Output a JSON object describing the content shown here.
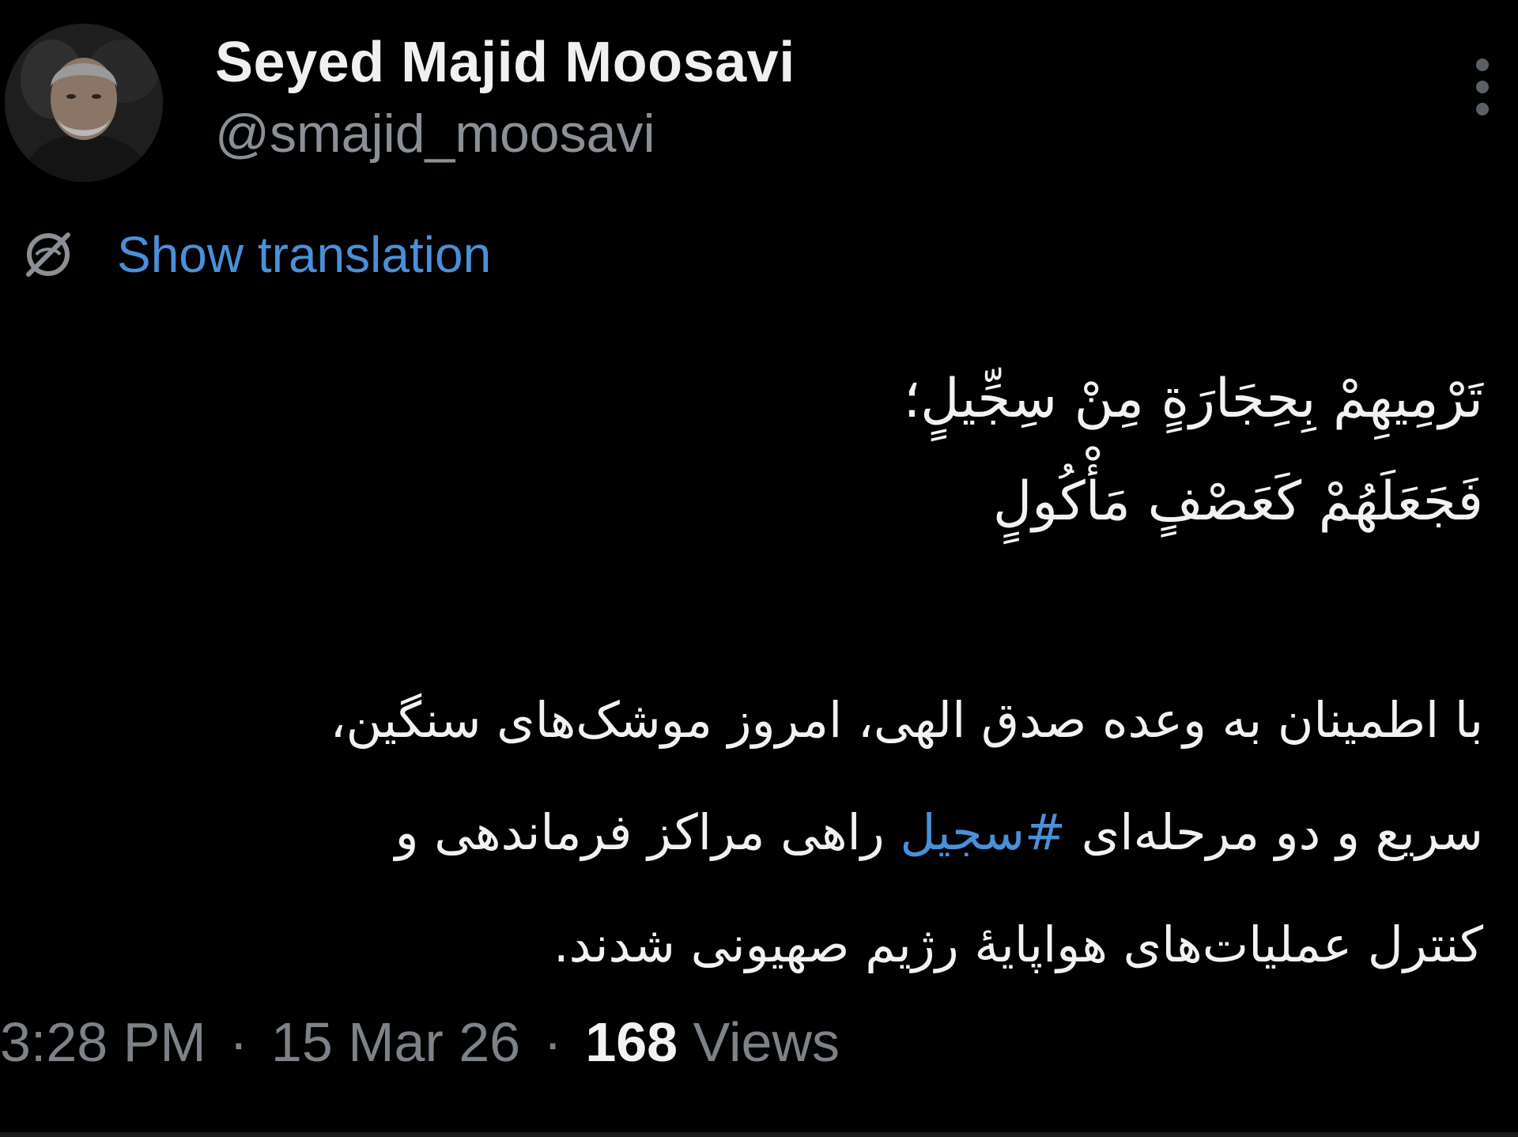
{
  "author": {
    "name": "Seyed Majid Moosavi",
    "handle": "@smajid_moosavi"
  },
  "icons": {
    "avatar": "profile-photo",
    "more": "more-options-icon",
    "translate": "translate-icon"
  },
  "translation": {
    "label": "Show translation"
  },
  "tweet": {
    "verse_lines": [
      "تَرْمِيهِمْ بِحِجَارَةٍ مِنْ سِجِّيلٍ؛",
      "فَجَعَلَهُمْ كَعَصْفٍ مَأْكُولٍ"
    ],
    "prose_line_1": "با اطمینان به وعده صدق الهی، امروز موشک‌های سنگین،",
    "prose_line_2_start": "سریع و دو مرحله‌ای ",
    "hashtag": "#سجیل",
    "prose_line_2_end": " راهی مراکز فرماندهی و",
    "prose_line_3": "کنترل عملیات‌های هواپایهٔ رژیم صهیونی شدند."
  },
  "meta": {
    "time": "3:28 PM",
    "separator": "·",
    "date": "15 Mar 26",
    "views_count": "168",
    "views_label": "Views"
  },
  "colors": {
    "background": "#000000",
    "link": "#4a90d9",
    "muted": "#7d8288",
    "text": "#f2f2f2"
  }
}
